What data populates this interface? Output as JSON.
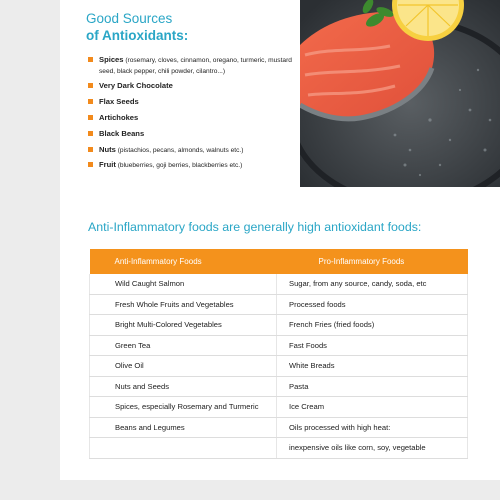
{
  "sources_panel": {
    "heading_line1": "Good Sources",
    "heading_line2": "of Antioxidants:",
    "items": [
      {
        "name": "Spices",
        "detail": " (rosemary, cloves, cinnamon, oregano, turmeric, mustard seed, black pepper, chili powder, cilantro...)"
      },
      {
        "name": "Very Dark Chocolate",
        "detail": ""
      },
      {
        "name": "Flax Seeds",
        "detail": ""
      },
      {
        "name": "Artichokes",
        "detail": ""
      },
      {
        "name": "Black Beans",
        "detail": ""
      },
      {
        "name": "Nuts",
        "detail": " (pistachios, pecans, almonds, walnuts etc.)"
      },
      {
        "name": "Fruit",
        "detail": " (blueberries, goji berries, blackberries etc.)"
      }
    ]
  },
  "photo": {
    "subject": "salmon-steak-with-lemon-in-pan"
  },
  "section": {
    "title": "Anti-Inflammatory foods are generally high antioxidant foods:"
  },
  "table": {
    "headers": [
      "Anti-Inflammatory Foods",
      "Pro-Inflammatory Foods"
    ],
    "rows": [
      [
        "Wild Caught Salmon",
        "Sugar, from any source, candy, soda, etc"
      ],
      [
        "Fresh Whole Fruits and Vegetables",
        "Processed foods"
      ],
      [
        "Bright Multi-Colored Vegetables",
        "French Fries (fried foods)"
      ],
      [
        "Green Tea",
        "Fast Foods"
      ],
      [
        "Olive Oil",
        "White Breads"
      ],
      [
        "Nuts and Seeds",
        "Pasta"
      ],
      [
        "Spices, especially Rosemary and Turmeric",
        "Ice Cream"
      ],
      [
        "Beans and Legumes",
        "Oils processed with high heat:"
      ],
      [
        "",
        "inexpensive oils like corn, soy, vegetable"
      ]
    ]
  },
  "colors": {
    "accent_teal": "#2aa6c6",
    "header_orange": "#f4921c",
    "bullet_orange": "#f28a1c"
  }
}
